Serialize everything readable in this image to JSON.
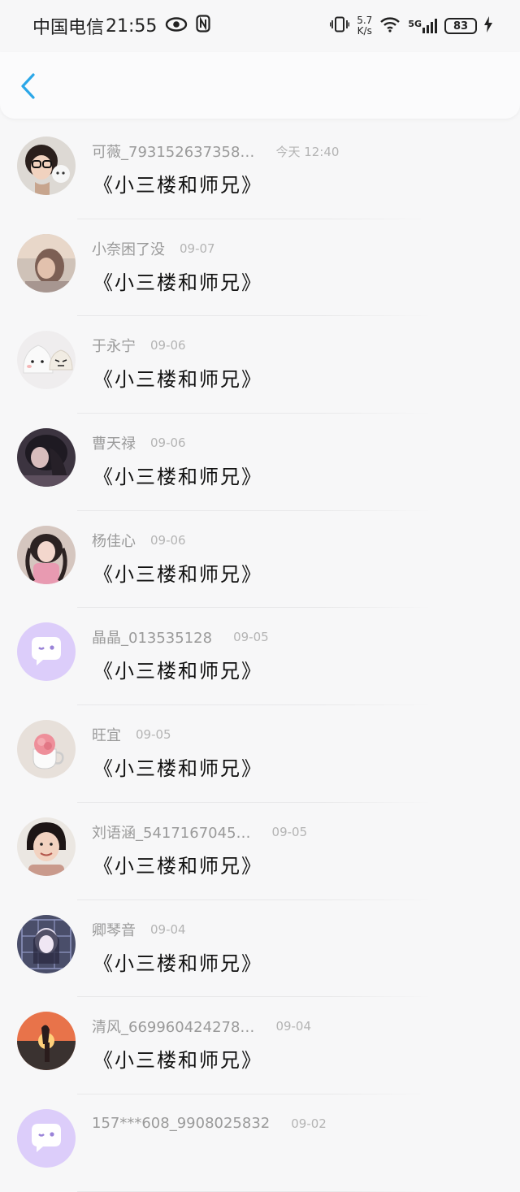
{
  "status_bar": {
    "carrier": "中国电信",
    "time": "21:55",
    "net_speed_value": "5.7",
    "net_speed_unit": "K/s",
    "network": "5G",
    "battery": "83"
  },
  "header": {
    "back_icon": "chevron-left-icon",
    "accent_color": "#2ba7e8"
  },
  "messages": [
    {
      "name": "可薇_793152637358…",
      "time": "今天 12:40",
      "text": "《小三楼和师兄》",
      "avatar": "girl-glasses-cat"
    },
    {
      "name": "小奈困了没",
      "time": "09-07",
      "text": "《小三楼和师兄》",
      "avatar": "girl-blurry"
    },
    {
      "name": "于永宁",
      "time": "09-06",
      "text": "《小三楼和师兄》",
      "avatar": "dumplings"
    },
    {
      "name": "曹天禄",
      "time": "09-06",
      "text": "《小三楼和师兄》",
      "avatar": "girl-dark"
    },
    {
      "name": "杨佳心",
      "time": "09-06",
      "text": "《小三楼和师兄》",
      "avatar": "girl-pink"
    },
    {
      "name": "晶晶_013535128",
      "time": "09-05",
      "text": "《小三楼和师兄》",
      "avatar": "default-chat"
    },
    {
      "name": "旺宜",
      "time": "09-05",
      "text": "《小三楼和师兄》",
      "avatar": "flower-cup"
    },
    {
      "name": "刘语涵_5417167045…",
      "time": "09-05",
      "text": "《小三楼和师兄》",
      "avatar": "girl-smile"
    },
    {
      "name": "卿琴音",
      "time": "09-04",
      "text": "《小三楼和师兄》",
      "avatar": "anime-girl"
    },
    {
      "name": "清风_669960424278…",
      "time": "09-04",
      "text": "《小三楼和师兄》",
      "avatar": "sunset"
    },
    {
      "name": "157***608_9908025832",
      "time": "09-02",
      "text": "",
      "avatar": "default-chat"
    }
  ]
}
